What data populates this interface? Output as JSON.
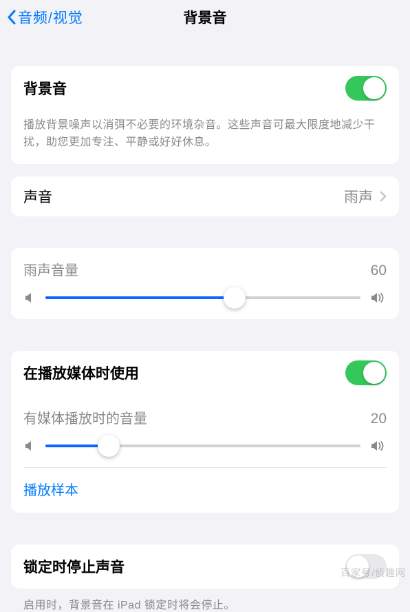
{
  "nav": {
    "back": "音频/视觉",
    "title": "背景音"
  },
  "section1": {
    "toggleLabel": "背景音",
    "toggleOn": true,
    "description": "播放背景噪声以消弭不必要的环境杂音。这些声音可最大限度地减少干扰，助您更加专注、平静或好好休息。"
  },
  "soundRow": {
    "label": "声音",
    "value": "雨声"
  },
  "volume1": {
    "label": "雨声音量",
    "value": "60",
    "percent": 60
  },
  "section2": {
    "toggleLabel": "在播放媒体时使用",
    "toggleOn": true,
    "volumeLabel": "有媒体播放时的音量",
    "volumeValue": "20",
    "percent": 20,
    "sampleLink": "播放样本"
  },
  "section3": {
    "toggleLabel": "锁定时停止声音",
    "toggleOn": false,
    "description": "启用时，背景音在 iPad 锁定时将会停止。"
  },
  "watermark": "百家号/侦趣网"
}
